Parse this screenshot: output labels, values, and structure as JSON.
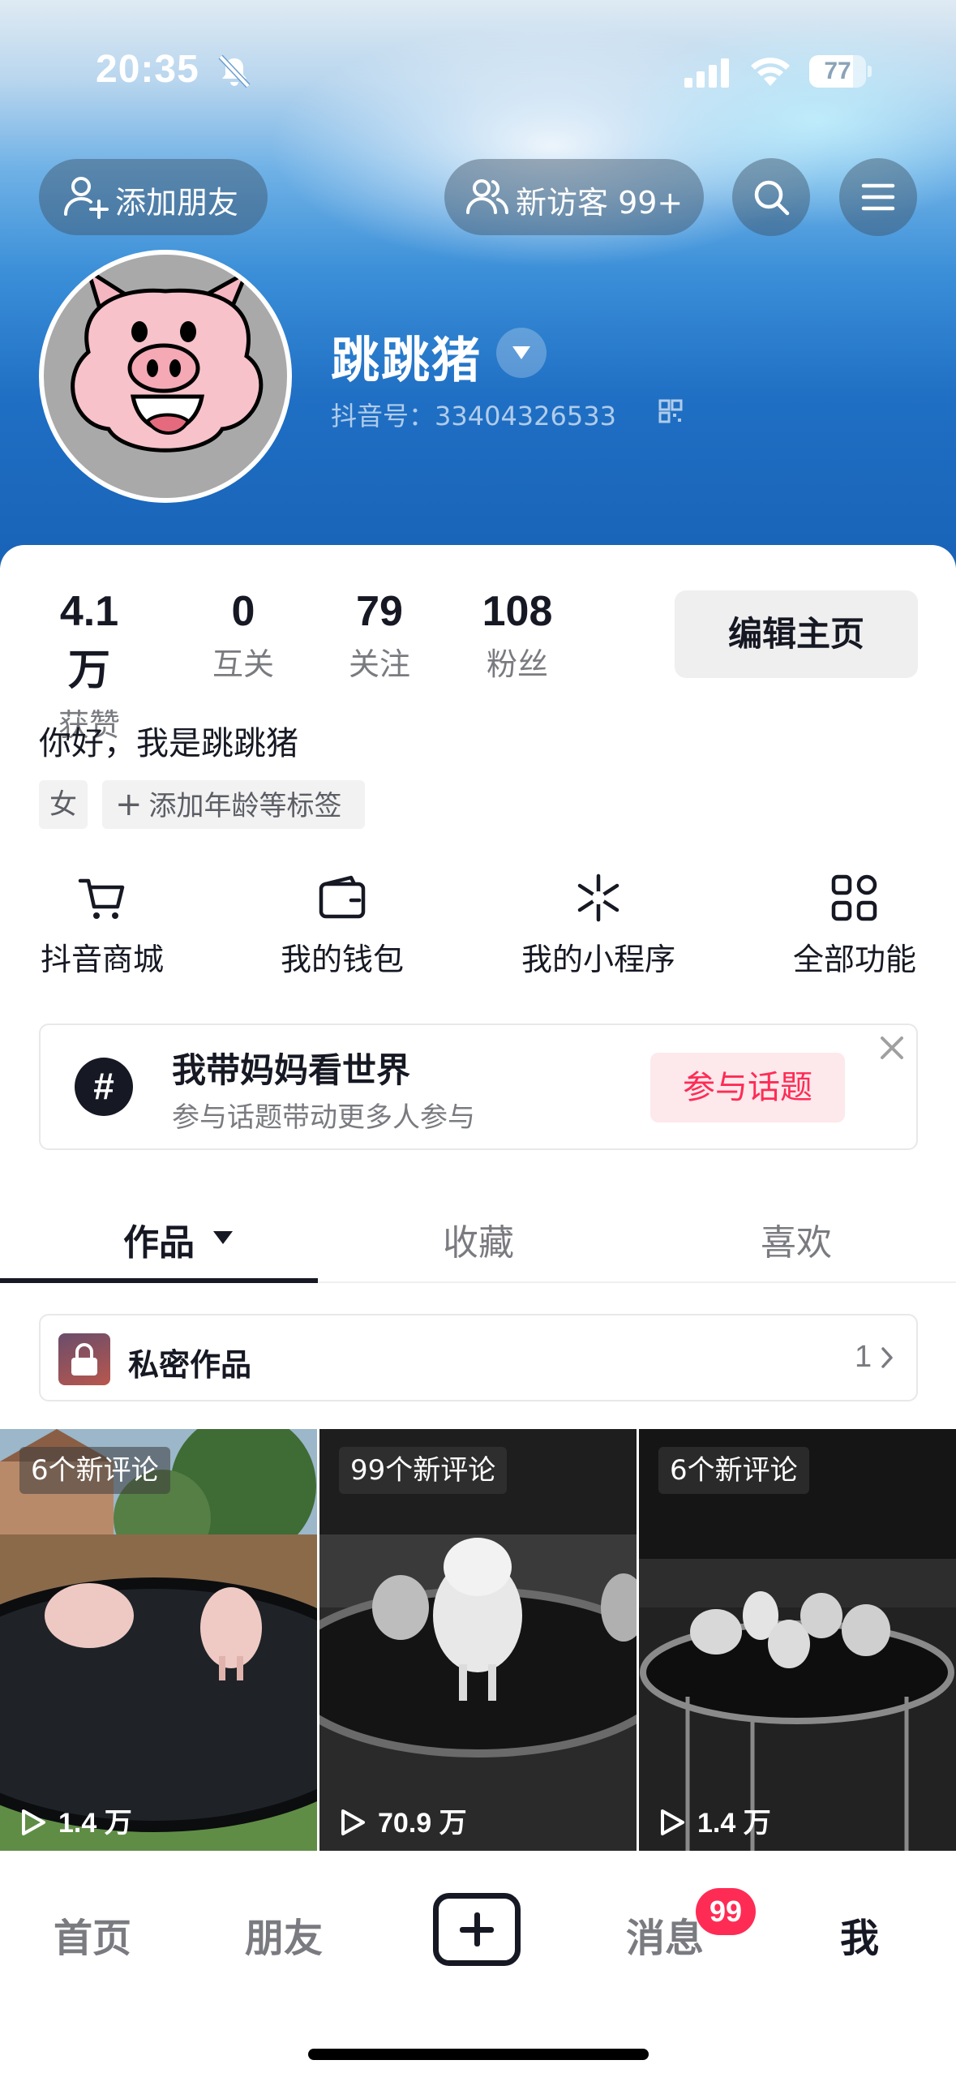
{
  "status_bar": {
    "time": "20:35",
    "battery": "77",
    "battery_level": 0.77
  },
  "header": {
    "add_friend_label": "添加朋友",
    "visitors_label": "新访客 99+",
    "username": "跳跳猪",
    "douyin_id": "抖音号：33404326533"
  },
  "stats": [
    {
      "value": "4.1万",
      "label": "获赞"
    },
    {
      "value": "0",
      "label": "互关"
    },
    {
      "value": "79",
      "label": "关注"
    },
    {
      "value": "108",
      "label": "粉丝"
    }
  ],
  "edit_profile_label": "编辑主页",
  "bio": "你好，我是跳跳猪",
  "tags": {
    "gender": "女",
    "add_tag": "添加年龄等标签",
    "add_symbol": "+"
  },
  "quick_actions": [
    {
      "label": "抖音商城",
      "icon": "cart-icon"
    },
    {
      "label": "我的钱包",
      "icon": "wallet-icon"
    },
    {
      "label": "我的小程序",
      "icon": "mini-program-icon"
    },
    {
      "label": "全部功能",
      "icon": "grid-icon"
    }
  ],
  "topic": {
    "symbol": "#",
    "title": "我带妈妈看世界",
    "subtitle": "参与话题带动更多人参与",
    "join_label": "参与话题"
  },
  "tabs": [
    {
      "label": "作品",
      "active": true
    },
    {
      "label": "收藏",
      "active": false
    },
    {
      "label": "喜欢",
      "active": false
    }
  ],
  "private_works": {
    "label": "私密作品",
    "count": "1"
  },
  "videos": [
    {
      "badge": "6个新评论",
      "plays": "1.4 万"
    },
    {
      "badge": "99个新评论",
      "plays": "70.9 万"
    },
    {
      "badge": "6个新评论",
      "plays": "1.4 万"
    }
  ],
  "bottom_nav": {
    "home": "首页",
    "friends": "朋友",
    "messages": "消息",
    "messages_badge": "99",
    "me": "我"
  },
  "colors": {
    "accent": "#fe2c55",
    "text": "#161823",
    "muted": "#7a7b80"
  }
}
